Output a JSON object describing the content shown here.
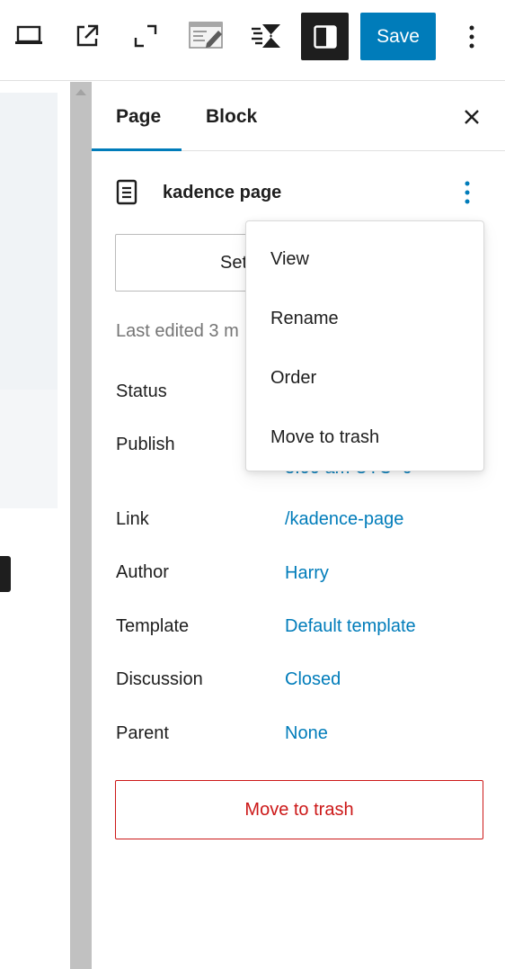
{
  "toolbar": {
    "save_label": "Save",
    "icons": [
      "desktop-preview-icon",
      "external-link-icon",
      "fullscreen-icon",
      "code-editor-icon",
      "kadence-icon",
      "sidebar-toggle-icon",
      "more-vertical-icon"
    ]
  },
  "sidebar": {
    "tabs": [
      {
        "label": "Page",
        "active": true
      },
      {
        "label": "Block",
        "active": false
      }
    ],
    "document": {
      "title": "kadence page",
      "set_button_label": "Set",
      "last_edited": "Last edited 3 m"
    },
    "properties": [
      {
        "label": "Status",
        "value": ""
      },
      {
        "label": "Publish",
        "value": "3:00 am UTC+0"
      },
      {
        "label": "Link",
        "value": "/kadence-page"
      },
      {
        "label": "Author",
        "value": "Harry"
      },
      {
        "label": "Template",
        "value": "Default template"
      },
      {
        "label": "Discussion",
        "value": "Closed"
      },
      {
        "label": "Parent",
        "value": "None"
      }
    ],
    "trash_button_label": "Move to trash"
  },
  "dropdown": {
    "items": [
      {
        "label": "View"
      },
      {
        "label": "Rename"
      },
      {
        "label": "Order"
      },
      {
        "label": "Move to trash"
      }
    ]
  },
  "colors": {
    "accent": "#007cba",
    "danger": "#cc1818",
    "text": "#1e1e1e",
    "muted": "#757575",
    "active_toggle": "#1e1e1e"
  }
}
